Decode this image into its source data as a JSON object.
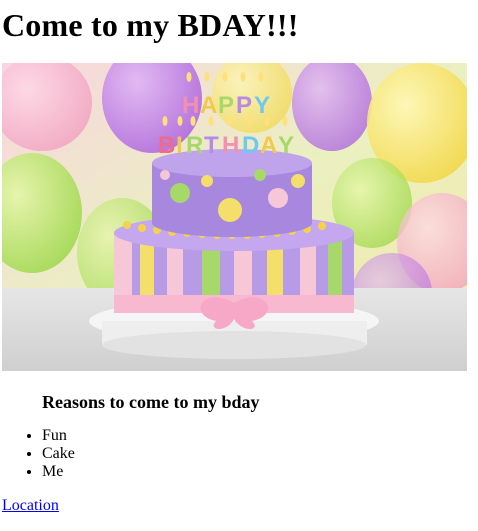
{
  "page": {
    "title": "Come to my BDAY!!!"
  },
  "hero_image": {
    "description_icon": "birthday-cake-image",
    "banner_text": "HAPPY BIRTHDAY"
  },
  "reasons": {
    "heading": "Reasons to come to my bday",
    "items": [
      "Fun",
      "Cake",
      "Me"
    ]
  },
  "link": {
    "label": "Location"
  },
  "colors": {
    "link": "#0000ee",
    "text": "#000000",
    "background": "#ffffff"
  }
}
